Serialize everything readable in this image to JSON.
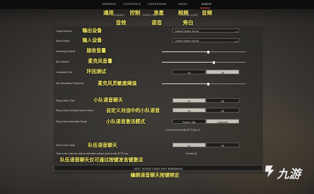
{
  "tabs": [
    {
      "label": "GENERAL",
      "active": false
    },
    {
      "label": "CONTROLS",
      "active": false
    },
    {
      "label": "CROSSHAIR",
      "active": false
    },
    {
      "label": "VIDEO",
      "active": false
    },
    {
      "label": "AUDIO",
      "active": true
    }
  ],
  "subtabs": [
    "SOUNDS",
    "VOICE CHAT",
    "VOICE-OVER"
  ],
  "annotations_top": [
    "通用",
    "控制",
    "准星",
    "视频",
    "音频",
    "音效",
    "语音",
    "旁白"
  ],
  "rows": {
    "output_device": {
      "label": "Output Device",
      "cn": "输出设备",
      "value": "Default System Device"
    },
    "input_device": {
      "label": "Input Device",
      "cn": "输入设备",
      "value": "Default System Device"
    },
    "incoming_volume": {
      "label": "Incoming Volume",
      "cn": "接收音量",
      "level": 0.55
    },
    "mic_volume": {
      "label": "Mic Volume",
      "cn": "麦克风音量",
      "level": 0.62
    },
    "loopback_test": {
      "label": "Loopback Test",
      "cn": "环回测试",
      "options": [
        "On",
        "Off"
      ],
      "selected": "Off"
    },
    "mic_sensitivity": {
      "label": "Mic Sensitivity Threshold",
      "cn": "麦克风灵敏度阈值",
      "level": 0.55
    },
    "party_voice_chat": {
      "label": "Party Voice Chat",
      "cn": "小队语音聊天",
      "options": [
        "On",
        "Off"
      ],
      "selected": "On"
    },
    "party_voice_custom": {
      "label": "Party Voice During Custom Game",
      "cn": "自定义对战中的小队语音",
      "options": [
        "On",
        "Off"
      ],
      "selected": "On"
    },
    "party_activation": {
      "label": "Party Voice Activation Mode",
      "cn": "小队语音激活模式",
      "options": [
        "Push to Talk",
        "Automatic"
      ],
      "selected": "Automatic"
    },
    "current_ptt_key": {
      "label": "Current push-to-talk (PTT) key: U"
    },
    "team_voice_chat": {
      "label": "Team Voice Chat",
      "cn": "队伍语音聊天",
      "options": [
        "On",
        "Off"
      ],
      "selected": "On"
    },
    "team_ptt_note": {
      "label": "Team voice chat can only be activated using a push-to-talk (PTT) key",
      "cn": "队伍语音聊天仅可通过按键发言键激活",
      "value": "Current ptt"
    }
  },
  "keybind_button": {
    "label": "EDIT VOICE CHAT KEY BINDINGS",
    "cn": "编辑语音聊天按键绑定"
  },
  "watermark": {
    "text": "九游"
  },
  "colors": {
    "annotation": "#fff36a",
    "active_tab_underline": "#e84a4a",
    "selected_segment": "#cdc8c0"
  }
}
